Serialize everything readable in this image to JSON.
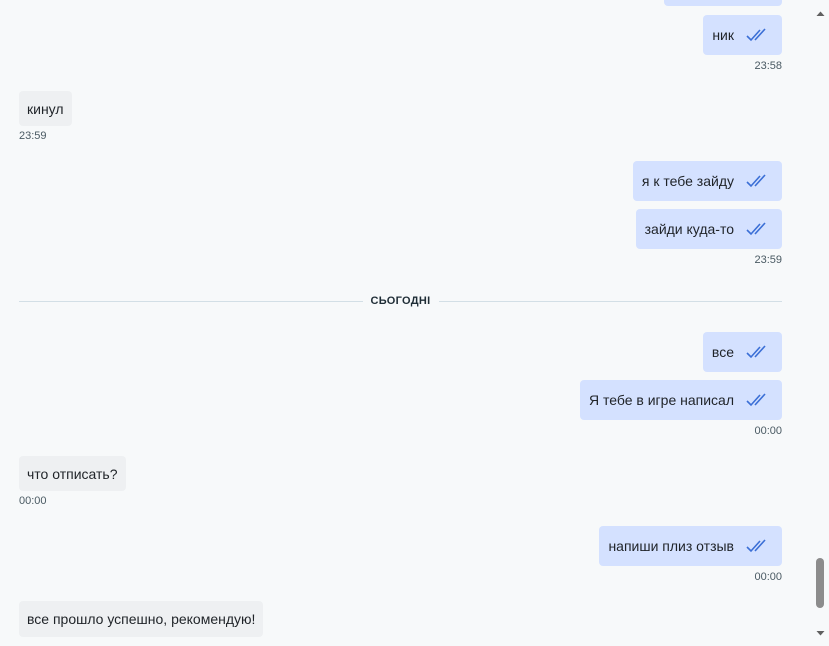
{
  "chat": {
    "messages": [
      {
        "id": "m1",
        "dir": "out",
        "text": "ник",
        "read": true
      },
      {
        "id": "m2",
        "dir": "in",
        "text": "кинул"
      },
      {
        "id": "m3",
        "dir": "out",
        "text": "я к тебе зайду",
        "read": true
      },
      {
        "id": "m4",
        "dir": "out",
        "text": "зайди куда-то",
        "read": true
      },
      {
        "id": "m5",
        "dir": "out",
        "text": "все",
        "read": true
      },
      {
        "id": "m6",
        "dir": "out",
        "text": "Я тебе в игре написал",
        "read": true
      },
      {
        "id": "m7",
        "dir": "in",
        "text": "что отписать?"
      },
      {
        "id": "m8",
        "dir": "out",
        "text": "напиши плиз отзыв",
        "read": true
      },
      {
        "id": "m9",
        "dir": "in",
        "text": "все прошло успешно, рекомендую!"
      }
    ],
    "times": {
      "t1": "23:58",
      "t2": "23:59",
      "t3": "23:59",
      "t4": "00:00",
      "t5": "00:00",
      "t6": "00:00"
    },
    "date_divider": "СЬОГОДНІ"
  },
  "icons": {
    "read_ticks": "double-check-icon",
    "scroll_up": "scroll-up-arrow-icon",
    "scroll_down": "scroll-down-arrow-icon"
  },
  "colors": {
    "outgoing_bubble": "#d4e1ff",
    "incoming_bubble": "#eef0f2",
    "ticks": "#3b6fd6",
    "background": "#f7f9fa"
  }
}
